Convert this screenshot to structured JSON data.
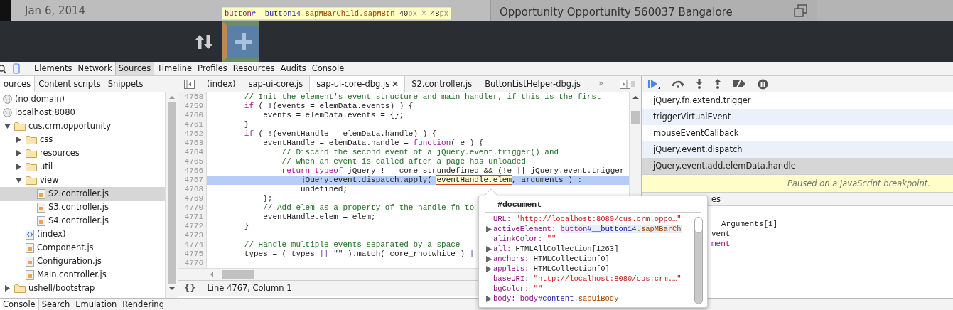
{
  "app": {
    "date": "Jan 6, 2014",
    "location": "Opportunity Opportunity 560037 Bangalore"
  },
  "inspect_tooltip": [
    {
      "text": "button",
      "kind": "tag"
    },
    {
      "text": "#__button14",
      "kind": "id"
    },
    {
      "text": ".sapMBarChild.sapMBtn",
      "kind": "class"
    },
    {
      "text": " 40",
      "kind": "num"
    },
    {
      "text": "px",
      "kind": "unit"
    },
    {
      "text": " × ",
      "kind": "unit"
    },
    {
      "text": "48",
      "kind": "num"
    },
    {
      "text": "px",
      "kind": "unit"
    }
  ],
  "main_tabs": [
    {
      "label": "Elements",
      "selected": false
    },
    {
      "label": "Network",
      "selected": false
    },
    {
      "label": "Sources",
      "selected": true
    },
    {
      "label": "Timeline",
      "selected": false
    },
    {
      "label": "Profiles",
      "selected": false
    },
    {
      "label": "Resources",
      "selected": false
    },
    {
      "label": "Audits",
      "selected": false
    },
    {
      "label": "Console",
      "selected": false
    }
  ],
  "navigator_tabs": [
    {
      "label": "ources",
      "selected": true
    },
    {
      "label": "Content scripts",
      "selected": false
    },
    {
      "label": "Snippets",
      "selected": false
    }
  ],
  "tree": [
    {
      "label": "(no domain)",
      "kind": "domain",
      "selected": false
    },
    {
      "label": "localhost:8080",
      "kind": "domain",
      "selected": false
    },
    {
      "label": "cus.crm.opportunity",
      "kind": "folder",
      "expanded": true,
      "selected": false,
      "children": [
        {
          "label": "css",
          "kind": "folder",
          "expanded": false,
          "selected": false
        },
        {
          "label": "resources",
          "kind": "folder",
          "expanded": false,
          "selected": false
        },
        {
          "label": "util",
          "kind": "folder",
          "expanded": false,
          "selected": false
        },
        {
          "label": "view",
          "kind": "folder",
          "expanded": true,
          "selected": false,
          "children": [
            {
              "label": "S2.controller.js",
              "kind": "script",
              "selected": true
            },
            {
              "label": "S3.controller.js",
              "kind": "script",
              "selected": false
            },
            {
              "label": "S4.controller.js",
              "kind": "script",
              "selected": false
            }
          ]
        },
        {
          "label": "(index)",
          "kind": "document",
          "selected": false
        },
        {
          "label": "Component.js",
          "kind": "script",
          "selected": false
        },
        {
          "label": "Configuration.js",
          "kind": "script",
          "selected": false
        },
        {
          "label": "Main.controller.js",
          "kind": "script",
          "selected": false
        }
      ]
    },
    {
      "label": "ushell/bootstrap",
      "kind": "folder",
      "expanded": false,
      "selected": false
    }
  ],
  "editor_tabs": [
    {
      "label": "(index)",
      "selected": false
    },
    {
      "label": "sap-ui-core.js",
      "selected": false
    },
    {
      "label": "sap-ui-core-dbg.js",
      "selected": true
    },
    {
      "label": "S2.controller.js",
      "selected": false
    },
    {
      "label": "ButtonListHelper-dbg.js",
      "selected": false
    }
  ],
  "tab_overflow": "»",
  "code": [
    {
      "number": "4758",
      "selected": false,
      "tokens": [
        {
          "text": "        // Init the element's event structure and main handler, if this is the first",
          "kind": "comment"
        }
      ]
    },
    {
      "number": "4759",
      "selected": false,
      "tokens": [
        {
          "text": "        if",
          "kind": "keyword"
        },
        {
          "text": " ( !(events = elemData.events) ) {",
          "kind": "plain"
        }
      ]
    },
    {
      "number": "4760",
      "selected": false,
      "tokens": [
        {
          "text": "            events = elemData.events = {};",
          "kind": "plain"
        }
      ]
    },
    {
      "number": "4761",
      "selected": false,
      "tokens": [
        {
          "text": "        }",
          "kind": "plain"
        }
      ]
    },
    {
      "number": "4762",
      "selected": false,
      "tokens": [
        {
          "text": "        if",
          "kind": "keyword"
        },
        {
          "text": " ( !(eventHandle = elemData.handle) ) {",
          "kind": "plain"
        }
      ]
    },
    {
      "number": "4763",
      "selected": false,
      "tokens": [
        {
          "text": "            eventHandle = elemData.handle = ",
          "kind": "plain"
        },
        {
          "text": "function",
          "kind": "keyword"
        },
        {
          "text": "( e ) {",
          "kind": "plain"
        }
      ]
    },
    {
      "number": "4764",
      "selected": false,
      "tokens": [
        {
          "text": "                // Discard the second event of a jQuery.event.trigger() and",
          "kind": "comment"
        }
      ]
    },
    {
      "number": "4765",
      "selected": false,
      "tokens": [
        {
          "text": "                // when an event is called after a page has unloaded",
          "kind": "comment"
        }
      ]
    },
    {
      "number": "4766",
      "selected": false,
      "tokens": [
        {
          "text": "                return typeof",
          "kind": "keyword"
        },
        {
          "text": " jQuery !== core_strundefined && (!e || jQuery.event.trigger",
          "kind": "plain"
        }
      ]
    },
    {
      "number": "4767",
      "selected": true,
      "tokens": [
        {
          "text": "                    jQuery.event.dispatch.apply( ",
          "kind": "plain"
        },
        {
          "text": "eventHandle.elem",
          "kind": "hover"
        },
        {
          "text": ", arguments ) :",
          "kind": "plain"
        }
      ]
    },
    {
      "number": "4768",
      "selected": false,
      "tokens": [
        {
          "text": "                    undefined;",
          "kind": "plain"
        }
      ]
    },
    {
      "number": "4769",
      "selected": false,
      "tokens": [
        {
          "text": "            };",
          "kind": "plain"
        }
      ]
    },
    {
      "number": "4770",
      "selected": false,
      "tokens": [
        {
          "text": "            // Add elem as a property of the handle fn to",
          "kind": "comment"
        }
      ]
    },
    {
      "number": "4771",
      "selected": false,
      "tokens": [
        {
          "text": "            eventHandle.elem = elem;",
          "kind": "plain"
        }
      ]
    },
    {
      "number": "4772",
      "selected": false,
      "tokens": [
        {
          "text": "        }",
          "kind": "plain"
        }
      ]
    },
    {
      "number": "4773",
      "selected": false
    },
    {
      "number": "4774",
      "selected": false,
      "tokens": [
        {
          "text": "        // Handle multiple events separated by a space",
          "kind": "comment"
        }
      ]
    },
    {
      "number": "4775",
      "selected": false,
      "tokens": [
        {
          "text": "        types = ( types ",
          "kind": "plain"
        },
        {
          "text": "||",
          "kind": "operator"
        },
        {
          "text": " \"\" ).match( core_rnotwhite ) ",
          "kind": "plain"
        },
        {
          "text": "|",
          "kind": "operator"
        }
      ]
    },
    {
      "number": "4776",
      "selected": false
    }
  ],
  "status": {
    "format": "{}",
    "position": "Line 4767, Column 1"
  },
  "call_stack": [
    {
      "label": "jQuery.fn.extend.trigger",
      "selected": false
    },
    {
      "label": "triggerVirtualEvent",
      "selected": false
    },
    {
      "label": "mouseEventCallback",
      "selected": false
    },
    {
      "label": "jQuery.event.dispatch",
      "selected": false
    },
    {
      "label": "jQuery.event.add.elemData.handle",
      "selected": true
    }
  ],
  "paused_message": "Paused on a JavaScript breakpoint.",
  "scope": {
    "header": "es",
    "lines": [
      {
        "text": "Arguments[1]",
        "kind": "object"
      },
      {
        "text": "vent",
        "kind": "plain"
      },
      {
        "text": "ment",
        "kind": "property"
      }
    ]
  },
  "popover": {
    "title": "#document",
    "rows": [
      {
        "name": "URL:",
        "expandable": false,
        "value": [
          {
            "text": "\"http://localhost:8080/cus.crm.oppo…\"",
            "kind": "string"
          }
        ]
      },
      {
        "name": "activeElement:",
        "expandable": true,
        "value": [
          {
            "text": "button",
            "kind": "tag"
          },
          {
            "text": "#__button14",
            "kind": "id"
          },
          {
            "text": ".sapMBarCh",
            "kind": "class"
          }
        ]
      },
      {
        "name": "alinkColor:",
        "expandable": false,
        "value": [
          {
            "text": "\"\"",
            "kind": "string"
          }
        ]
      },
      {
        "name": "all:",
        "expandable": true,
        "value": [
          {
            "text": "HTMLAllCollection[1263]",
            "kind": "object"
          }
        ]
      },
      {
        "name": "anchors:",
        "expandable": true,
        "value": [
          {
            "text": "HTMLCollection[0]",
            "kind": "object"
          }
        ]
      },
      {
        "name": "applets:",
        "expandable": true,
        "value": [
          {
            "text": "HTMLCollection[0]",
            "kind": "object"
          }
        ]
      },
      {
        "name": "baseURI:",
        "expandable": false,
        "value": [
          {
            "text": "\"http://localhost:8080/cus.crm.…\"",
            "kind": "string"
          }
        ]
      },
      {
        "name": "bgColor:",
        "expandable": false,
        "value": [
          {
            "text": "\"\"",
            "kind": "string"
          }
        ]
      },
      {
        "name": "body:",
        "expandable": true,
        "value": [
          {
            "text": "body",
            "kind": "tag"
          },
          {
            "text": "#content",
            "kind": "id"
          },
          {
            "text": ".sapUiBody",
            "kind": "class"
          }
        ]
      }
    ]
  },
  "drawer_tabs": [
    {
      "label": "Console",
      "selected": true
    },
    {
      "label": "Search",
      "selected": false
    },
    {
      "label": "Emulation",
      "selected": false
    },
    {
      "label": "Rendering",
      "selected": false
    }
  ]
}
